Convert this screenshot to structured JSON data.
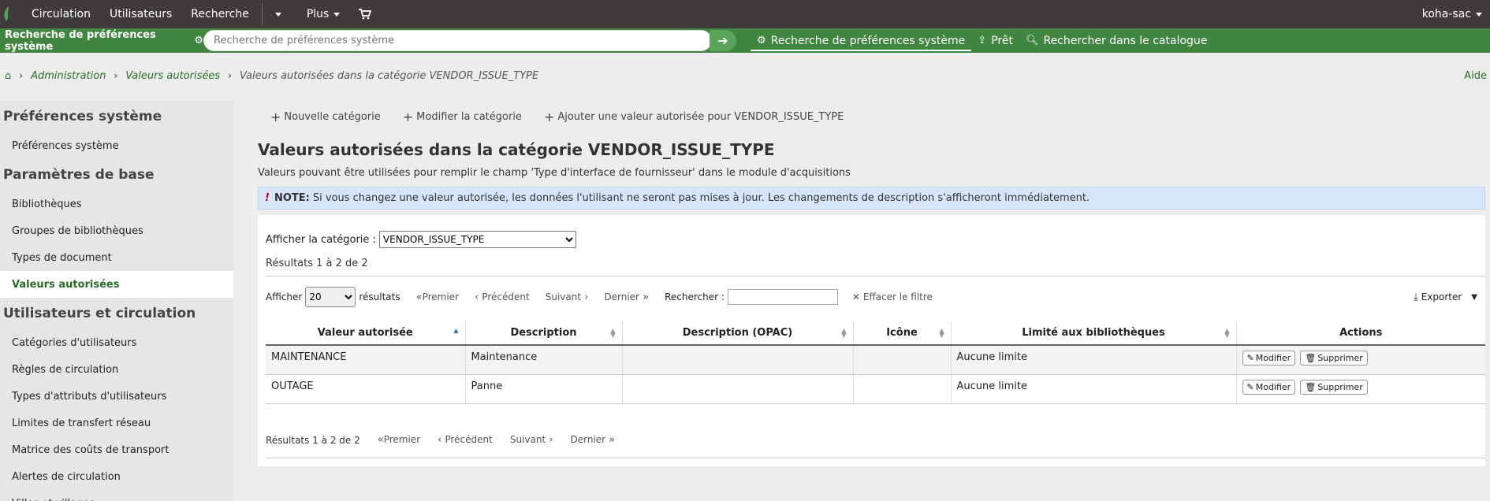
{
  "topbar": {
    "items": [
      "Circulation",
      "Utilisateurs",
      "Recherche",
      "Plus"
    ],
    "user": "koha-sac"
  },
  "searchbar": {
    "label": "Recherche de préférences système",
    "placeholder": "Recherche de préférences système",
    "tabs": [
      "Recherche de préférences système",
      "Prêt",
      "Rechercher dans le catalogue"
    ]
  },
  "breadcrumb": {
    "items": [
      "Administration",
      "Valeurs autorisées"
    ],
    "current": "Valeurs autorisées dans la catégorie VENDOR_ISSUE_TYPE",
    "help": "Aide"
  },
  "sidebar": {
    "sections": [
      {
        "title": "Préférences système",
        "items": [
          "Préférences système"
        ]
      },
      {
        "title": "Paramètres de base",
        "items": [
          "Bibliothèques",
          "Groupes de bibliothèques",
          "Types de document",
          "Valeurs autorisées"
        ]
      },
      {
        "title": "Utilisateurs et circulation",
        "items": [
          "Catégories d'utilisateurs",
          "Règles de circulation",
          "Types d'attributs d'utilisateurs",
          "Limites de transfert réseau",
          "Matrice des coûts de transport",
          "Alertes de circulation",
          "Villes et villages"
        ]
      }
    ],
    "active": "Valeurs autorisées"
  },
  "toolbar": {
    "new_category": "Nouvelle catégorie",
    "edit_category": "Modifier la catégorie",
    "add_value": "Ajouter une valeur autorisée pour VENDOR_ISSUE_TYPE"
  },
  "page": {
    "title": "Valeurs autorisées dans la catégorie VENDOR_ISSUE_TYPE",
    "description": "Valeurs pouvant être utilisées pour remplir le champ 'Type d'interface de fournisseur' dans le module d'acquisitions",
    "note_label": "NOTE:",
    "note_text": "Si vous changez une valeur autorisée, les données l'utilisant ne seront pas mises à jour. Les changements de description s'afficheront immédiatement."
  },
  "panel": {
    "show_category_label": "Afficher la catégorie :",
    "category_value": "VENDOR_ISSUE_TYPE",
    "results_top": "Résultats 1 à 2 de 2",
    "show_label": "Afficher",
    "page_size": "20",
    "results_label": "résultats",
    "first": "Premier",
    "previous": "Précédent",
    "next": "Suivant",
    "last": "Dernier",
    "search_label": "Rechercher :",
    "clear_filter": "Effacer le filtre",
    "export": "Exporter",
    "results_bottom": "Résultats 1 à 2 de 2"
  },
  "table": {
    "headers": [
      "Valeur autorisée",
      "Description",
      "Description (OPAC)",
      "Icône",
      "Limité aux bibliothèques",
      "Actions"
    ],
    "rows": [
      {
        "value": "MAINTENANCE",
        "description": "Maintenance",
        "opac": "",
        "icon": "",
        "limit": "Aucune limite"
      },
      {
        "value": "OUTAGE",
        "description": "Panne",
        "opac": "",
        "icon": "",
        "limit": "Aucune limite"
      }
    ],
    "edit_label": "Modifier",
    "delete_label": "Supprimer"
  }
}
